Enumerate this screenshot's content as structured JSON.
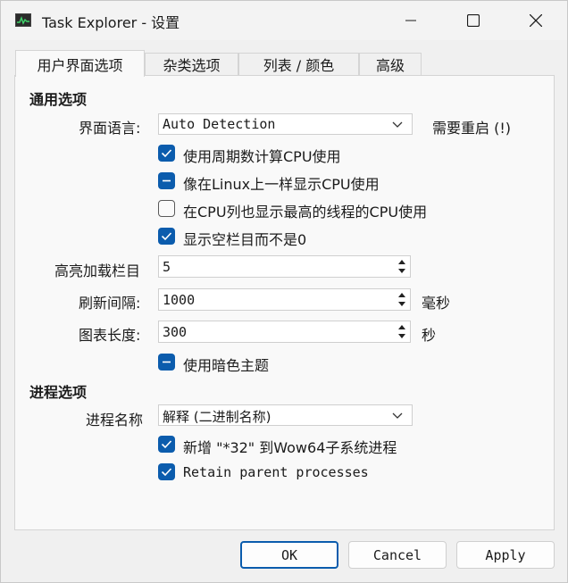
{
  "window": {
    "title": "Task Explorer - 设置"
  },
  "tabs": [
    {
      "label": "用户界面选项"
    },
    {
      "label": "杂类选项"
    },
    {
      "label": "列表 / 颜色"
    },
    {
      "label": "高级"
    }
  ],
  "general": {
    "section_title": "通用选项",
    "language_label": "界面语言:",
    "language_value": "Auto Detection",
    "restart_note": "需要重启 (!)",
    "checkboxes": [
      {
        "label": "使用周期数计算CPU使用",
        "state": "checked"
      },
      {
        "label": "像在Linux上一样显示CPU使用",
        "state": "indeterminate"
      },
      {
        "label": "在CPU列也显示最高的线程的CPU使用",
        "state": "unchecked"
      },
      {
        "label": "显示空栏目而不是0",
        "state": "checked"
      }
    ],
    "highlight_label": "高亮加载栏目",
    "highlight_value": "5",
    "refresh_label": "刷新间隔:",
    "refresh_value": "1000",
    "refresh_unit": "毫秒",
    "graph_label": "图表长度:",
    "graph_value": "300",
    "graph_unit": "秒",
    "dark_theme_label": "使用暗色主题",
    "dark_theme_state": "indeterminate"
  },
  "process": {
    "section_title": "进程选项",
    "name_label": "进程名称",
    "name_value": "解释 (二进制名称)",
    "checkboxes": [
      {
        "label": "新增 \"*32\" 到Wow64子系统进程",
        "state": "checked"
      },
      {
        "label": "Retain parent processes",
        "state": "checked"
      }
    ]
  },
  "buttons": {
    "ok": "OK",
    "cancel": "Cancel",
    "apply": "Apply"
  },
  "colors": {
    "accent": "#0b5cad",
    "panel": "#f9f9f9"
  }
}
